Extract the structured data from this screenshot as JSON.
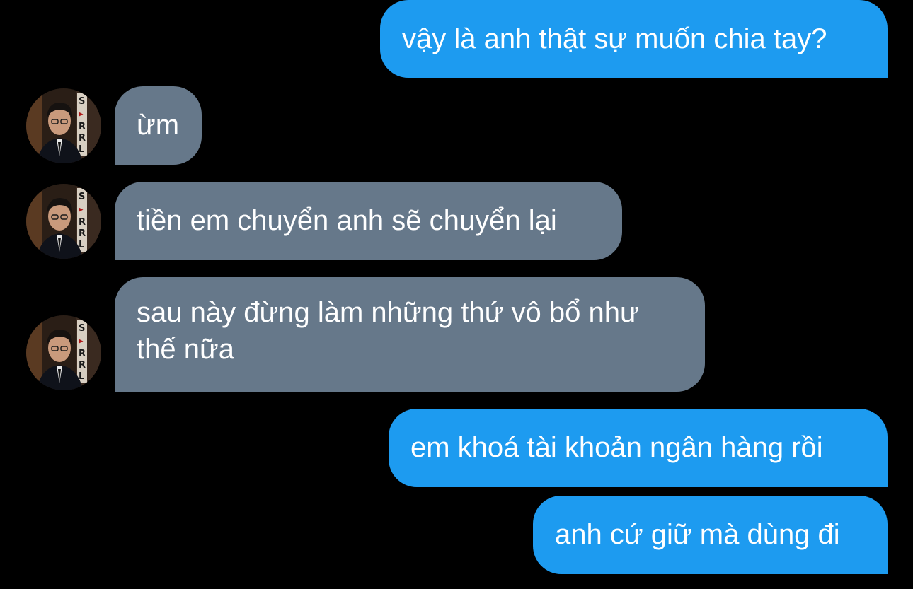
{
  "conversation": {
    "messages": [
      {
        "sender": "me",
        "text": "vậy là anh thật sự muốn chia tay?"
      },
      {
        "sender": "contact",
        "text": "ừm"
      },
      {
        "sender": "contact",
        "text": "tiền em chuyển anh sẽ chuyển lại"
      },
      {
        "sender": "contact",
        "text": "sau này đừng làm những thứ vô bổ như thế nữa"
      },
      {
        "sender": "me",
        "text": "em khoá tài khoản ngân hàng rồi"
      },
      {
        "sender": "me",
        "text": "anh cứ giữ mà dùng đi"
      }
    ]
  },
  "contact": {
    "avatar_icon": "contact-portrait-avatar"
  },
  "colors": {
    "background": "#000000",
    "sent_bubble": "#1d9bf0",
    "received_bubble": "#66788a",
    "text": "#ffffff"
  }
}
